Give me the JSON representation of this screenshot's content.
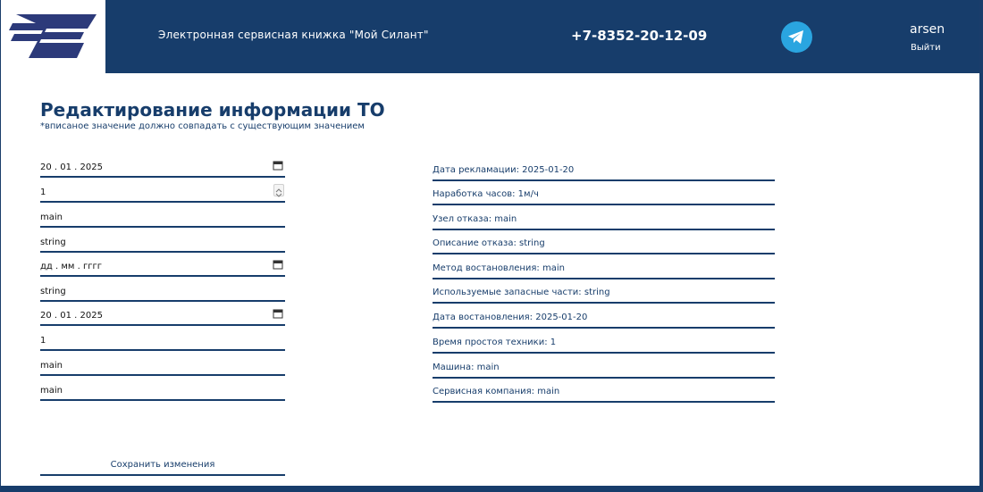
{
  "header": {
    "title": "Электронная сервисная книжка \"Мой Силант\"",
    "phone": "+7-8352-20-12-09",
    "user": "arsen",
    "logout": "Выйти"
  },
  "page": {
    "title": "Редактирование информации ТО",
    "note": "*вписаное значение должно совпадать с существующим значением"
  },
  "form": {
    "fields": [
      {
        "value": "20 . 01 . 2025"
      },
      {
        "value": "1"
      },
      {
        "value": "main"
      },
      {
        "value": "string"
      },
      {
        "value": "дд . мм . гггг"
      },
      {
        "value": "string"
      },
      {
        "value": "20 . 01 . 2025"
      },
      {
        "value": "1"
      },
      {
        "value": "main"
      },
      {
        "value": "main"
      }
    ],
    "save_label": "Сохранить изменения"
  },
  "info": [
    "Дата рекламации: 2025-01-20",
    "Наработка часов: 1м/ч",
    "Узел отказа: main",
    "Описание отказа: string",
    "Метод востановления: main",
    "Используемые запасные части: string",
    "Дата востановления: 2025-01-20",
    "Время простоя техники: 1",
    "Машина: main",
    "Сервисная компания: main"
  ],
  "colors": {
    "brand": "#173d6b",
    "telegram": "#2aa5e0"
  }
}
